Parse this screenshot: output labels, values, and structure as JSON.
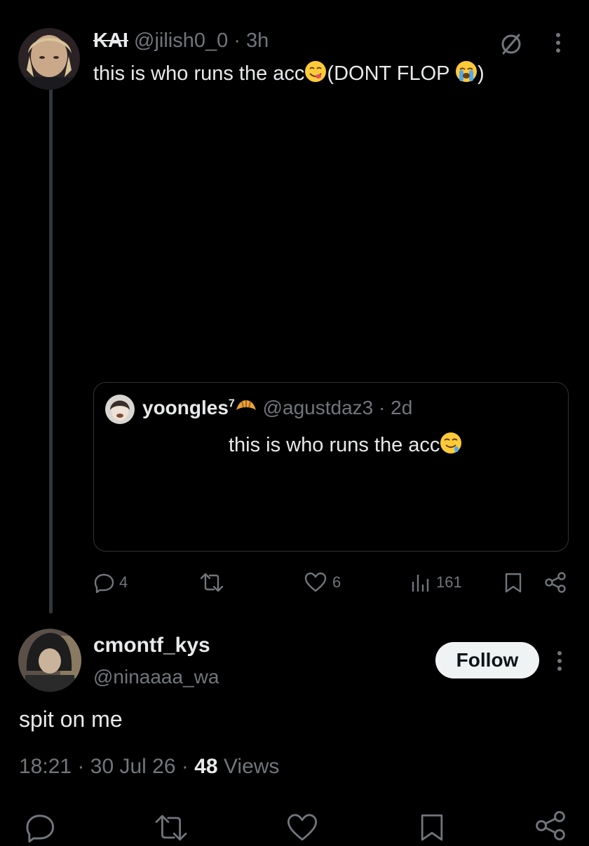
{
  "tweet": {
    "display_name": "KAI",
    "handle": "@jilish0_0",
    "separator": "·",
    "time": "3h",
    "text_part1": "this is who runs the acc",
    "text_part2": "(DONT FLOP ",
    "text_part3": ")"
  },
  "quoted": {
    "display_name": "yoongles",
    "superscript": "7",
    "handle": "@agustdaz3",
    "separator": "·",
    "time": "2d",
    "text": "this is who runs the acc"
  },
  "actions": {
    "replies": "4",
    "likes": "6",
    "views": "161"
  },
  "reply": {
    "display_name": "cmontf_kys",
    "handle": "@ninaaaa_wa",
    "follow_label": "Follow",
    "text": "spit on me",
    "time": "18:21",
    "separator": "·",
    "date": "30 Jul 26",
    "views_count": "48",
    "views_label": "Views"
  },
  "icons": {
    "grok": "slashed-circle-icon",
    "more": "more-vertical-icon",
    "reply": "reply-icon",
    "retweet": "retweet-icon",
    "like": "heart-icon",
    "analytics": "analytics-icon",
    "bookmark": "bookmark-icon",
    "share": "share-icon"
  },
  "colors": {
    "background": "#000000",
    "text": "#e7e9ea",
    "muted": "#71767b",
    "follow_bg": "#eff3f4"
  }
}
